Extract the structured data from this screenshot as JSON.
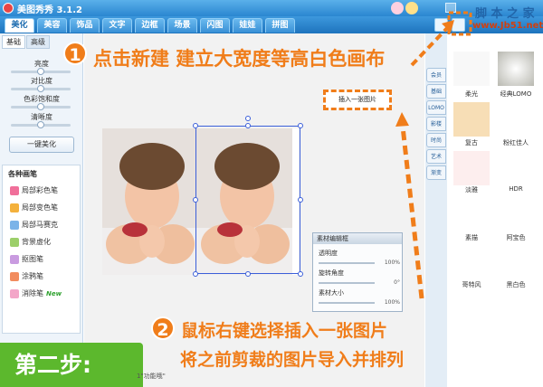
{
  "window": {
    "title": "美图秀秀 3.1.2"
  },
  "main_tabs": [
    "美化",
    "美容",
    "饰品",
    "文字",
    "边框",
    "场景",
    "闪图",
    "娃娃",
    "拼图"
  ],
  "sub_tabs": [
    "基础",
    "高级"
  ],
  "sliders": [
    {
      "label": "亮度",
      "value": 0.5
    },
    {
      "label": "对比度",
      "value": 0.5
    },
    {
      "label": "色彩饱和度",
      "value": 0.5
    },
    {
      "label": "清晰度",
      "value": 0.5
    }
  ],
  "beautify_button": "一键美化",
  "brushes": {
    "title": "各种画笔",
    "items": [
      "局部彩色笔",
      "局部变色笔",
      "局部马赛克",
      "背景虚化",
      "抠图笔",
      "涂鸦笔",
      "消除笔"
    ],
    "new_badge": "New"
  },
  "insert_label": "插入一张图片",
  "material_editor": {
    "title": "素材编辑框",
    "rows": [
      {
        "label": "透明度",
        "value": "100%"
      },
      {
        "label": "旋转角度",
        "value": "0°"
      },
      {
        "label": "素材大小",
        "value": "100%"
      }
    ]
  },
  "right_tabs": [
    "会员",
    "基础",
    "LOMO",
    "影楼",
    "时尚",
    "艺术",
    "渐变"
  ],
  "effects": [
    "柔光",
    "经典LOMO",
    "复古",
    "粉红佳人",
    "淡雅",
    "HDR",
    "素描",
    "阿宝色",
    "哥特风",
    "黑白色"
  ],
  "annotations": {
    "step1_number": "1",
    "step1_text": "点击新建 建立大宽度等高白色画布",
    "step2_number": "2",
    "step2_line1": "鼠标右键选择插入一张图片",
    "step2_line2": "将之前剪裁的图片导入并排列",
    "banner": "第二步:"
  },
  "func_text": "1\"功能哦\"",
  "watermark": {
    "line1": "脚 本 之 家",
    "line2": "www.Jb51.net"
  },
  "colors": {
    "accent": "#f07d1a",
    "banner": "#5cb82d",
    "title_bar": "#2a86d0"
  }
}
